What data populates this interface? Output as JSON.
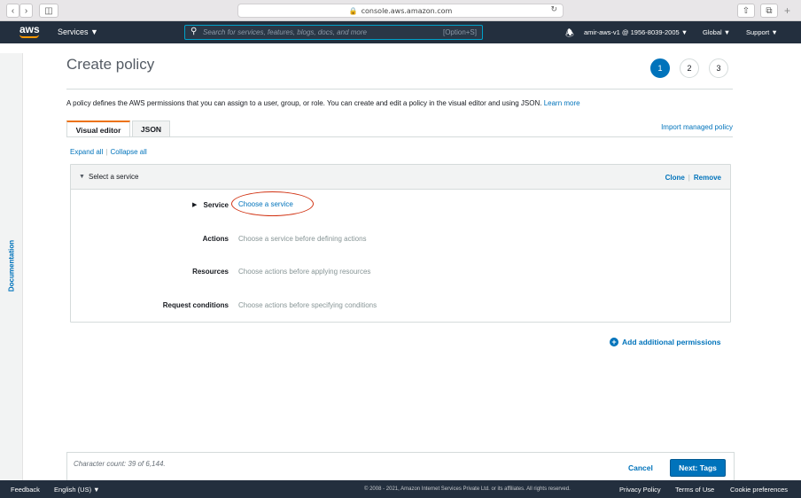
{
  "browser": {
    "url": "console.aws.amazon.com"
  },
  "nav": {
    "logo": "aws",
    "services": "Services ▼",
    "search_placeholder": "Search for services, features, blogs, docs, and more",
    "search_shortcut": "[Option+S]",
    "account": "amir-aws-v1 @ 1956-8039-2005 ▼",
    "region": "Global ▼",
    "support": "Support ▼"
  },
  "sidebar": {
    "documentation": "Documentation"
  },
  "page": {
    "title": "Create policy",
    "steps": [
      "1",
      "2",
      "3"
    ],
    "description": "A policy defines the AWS permissions that you can assign to a user, group, or role. You can create and edit a policy in the visual editor and using JSON.",
    "learn_more": "Learn more",
    "tabs": [
      "Visual editor",
      "JSON"
    ],
    "import_policy": "Import managed policy",
    "expand_all": "Expand all",
    "collapse_all": "Collapse all"
  },
  "panel": {
    "header": "Select a service",
    "clone": "Clone",
    "remove": "Remove",
    "rows": [
      {
        "label": "Service",
        "value": "Choose a service"
      },
      {
        "label": "Actions",
        "value": "Choose a service before defining actions"
      },
      {
        "label": "Resources",
        "value": "Choose actions before applying resources"
      },
      {
        "label": "Request conditions",
        "value": "Choose actions before specifying conditions"
      }
    ]
  },
  "add_permissions": "Add additional permissions",
  "bottom": {
    "char_count": "Character count: 39 of 6,144.",
    "cancel": "Cancel",
    "next": "Next: Tags"
  },
  "footer": {
    "feedback": "Feedback",
    "language": "English (US) ▼",
    "copyright": "© 2008 - 2021, Amazon Internet Services Private Ltd. or its affiliates. All rights reserved.",
    "privacy": "Privacy Policy",
    "terms": "Terms of Use",
    "cookies": "Cookie preferences"
  }
}
